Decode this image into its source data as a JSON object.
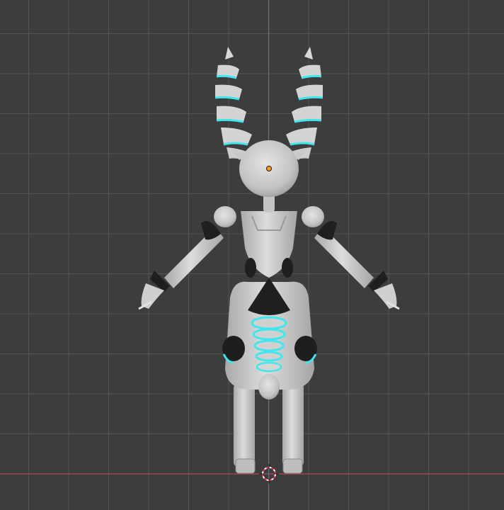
{
  "viewport": {
    "view": "front-orthographic",
    "colors": {
      "background": "#3d3d3d",
      "grid_minor": "#4a4a4a",
      "grid_major": "#545454",
      "axis_x": "#b5485a",
      "axis_z": "#4d73b8",
      "model_body": "#c9c9c9",
      "model_shadow": "#9e9e9e",
      "model_dark": "#1f1f1f",
      "glow": "#3fe6ee",
      "origin_point": "#ff9a1a"
    }
  },
  "objects": {
    "model": {
      "icon": "robot-rabbit-figure"
    },
    "origin": {
      "icon": "origin-dot"
    },
    "cursor_3d": {
      "icon": "3d-cursor-icon"
    }
  }
}
